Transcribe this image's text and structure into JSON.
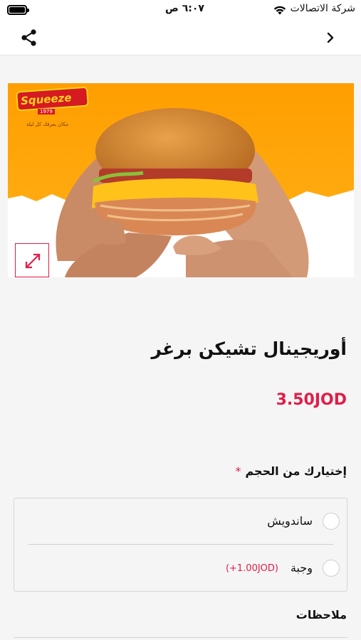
{
  "status_bar": {
    "time": "٦:٠٧ ص",
    "carrier": "شركة الاتصالات",
    "icons": [
      "battery-icon",
      "wifi-icon"
    ]
  },
  "nav": {
    "icons": [
      "share-icon",
      "chevron-right-icon"
    ]
  },
  "hero": {
    "logo_text": "Squeeze",
    "logo_year": "1979",
    "logo_tagline": "مكان يعرفك كل ليلة",
    "expand_icon": "expand-arrows-icon"
  },
  "product": {
    "title": "أوريجينال تشيكن برغر",
    "price": "3.50JOD"
  },
  "size_section": {
    "heading": "إختيارك من الحجم",
    "required_mark": "*",
    "options": [
      {
        "label": "ساندويش",
        "extra": ""
      },
      {
        "label": "وجبة",
        "extra": "(+1.00JOD)"
      }
    ]
  },
  "notes": {
    "heading": "ملاحظات"
  },
  "colors": {
    "accent": "#e11d48",
    "hero_bg": "#ffa300",
    "page_bg": "#f5f5f5"
  }
}
